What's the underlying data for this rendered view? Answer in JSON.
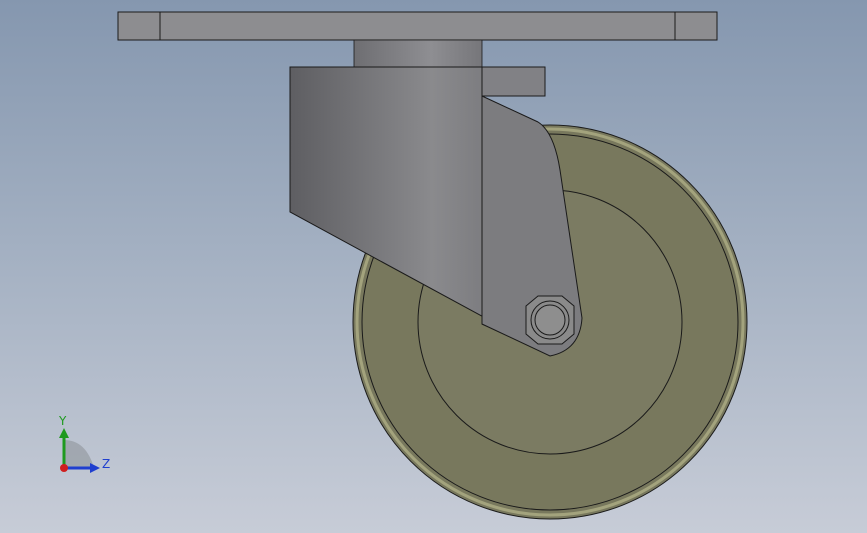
{
  "viewport": {
    "background_top": "#8597af",
    "background_bottom": "#c7ccd7"
  },
  "model": {
    "colors": {
      "plate": "#8d8d90",
      "stem": "#7e7e82",
      "bracket_dark": "#5e5e62",
      "bracket_light": "#8a8a8d",
      "fork_arm": "#7c7c7f",
      "wheel_tire": "#78785d",
      "wheel_rim": "#a3a37d",
      "hub": "#7b7b62",
      "nut": "#8a8a8a",
      "outline": "#1a1a1a"
    }
  },
  "triad": {
    "y_label": "Y",
    "z_label": "Z",
    "y_color": "#1f9a1f",
    "z_color": "#1f3fcf",
    "x_color": "#cf1f1f"
  }
}
